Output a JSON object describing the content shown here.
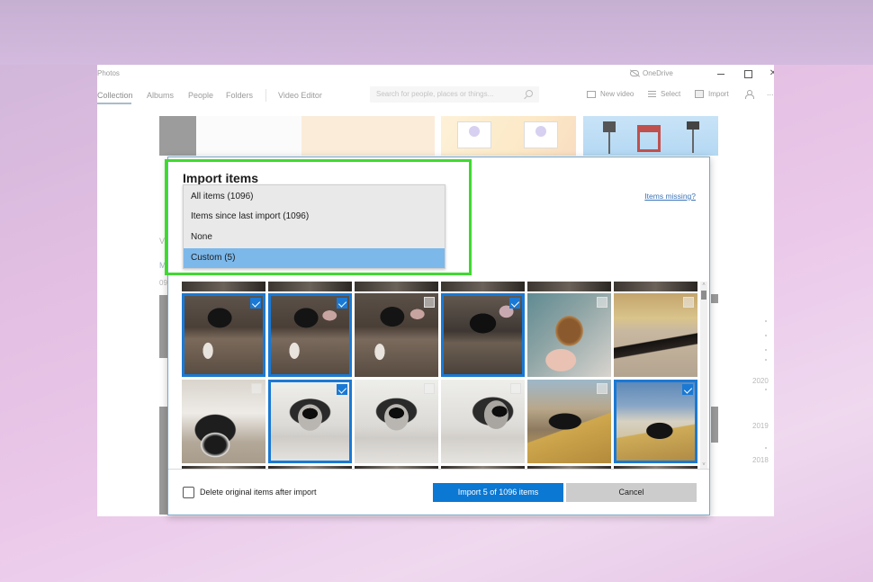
{
  "app": {
    "title": "Photos",
    "onedrive_label": "OneDrive",
    "nav_tabs": [
      {
        "label": "Collection",
        "active": true
      },
      {
        "label": "Albums",
        "active": false
      },
      {
        "label": "People",
        "active": false
      },
      {
        "label": "Folders",
        "active": false
      },
      {
        "label": "Video Editor",
        "active": false
      }
    ],
    "search_placeholder": "Search for people, places or things...",
    "toolbar": {
      "new_video": "New video",
      "select": "Select",
      "import": "Import",
      "more": "..."
    },
    "background_fragments": {
      "left_v": "V",
      "left_m": "M",
      "left_date": "09"
    },
    "timeline_years": [
      "2020",
      "2019",
      "2018"
    ]
  },
  "dialog": {
    "title": "Import items",
    "items_missing_link": "Items missing?",
    "dropdown": {
      "options": [
        {
          "label": "All items (1096)",
          "selected": false
        },
        {
          "label": "Items since last import (1096)",
          "selected": false
        },
        {
          "label": "None",
          "selected": false
        },
        {
          "label": "Custom (5)",
          "selected": true
        }
      ]
    },
    "photos": [
      {
        "subject": "dog on couch",
        "selected": true
      },
      {
        "subject": "dog on couch",
        "selected": true
      },
      {
        "subject": "dog on couch",
        "selected": false
      },
      {
        "subject": "dog on blanket",
        "selected": true
      },
      {
        "subject": "burrito in hand",
        "selected": false
      },
      {
        "subject": "dog lying on floor",
        "selected": false
      },
      {
        "subject": "dog nose close-up",
        "selected": false
      },
      {
        "subject": "dog on rug",
        "selected": true
      },
      {
        "subject": "dog on rug",
        "selected": false
      },
      {
        "subject": "dog on rug",
        "selected": false
      },
      {
        "subject": "dog on sofa arm",
        "selected": false
      },
      {
        "subject": "dog on sofa by window",
        "selected": true
      }
    ],
    "delete_checkbox": {
      "label": "Delete original items after import",
      "checked": false
    },
    "import_button": "Import 5 of 1096 items",
    "cancel_button": "Cancel"
  },
  "colors": {
    "accent_blue": "#0b78d3",
    "selected_option": "#7db8ea",
    "highlight_green": "#3fd92f",
    "link_blue": "#3b74b8"
  }
}
